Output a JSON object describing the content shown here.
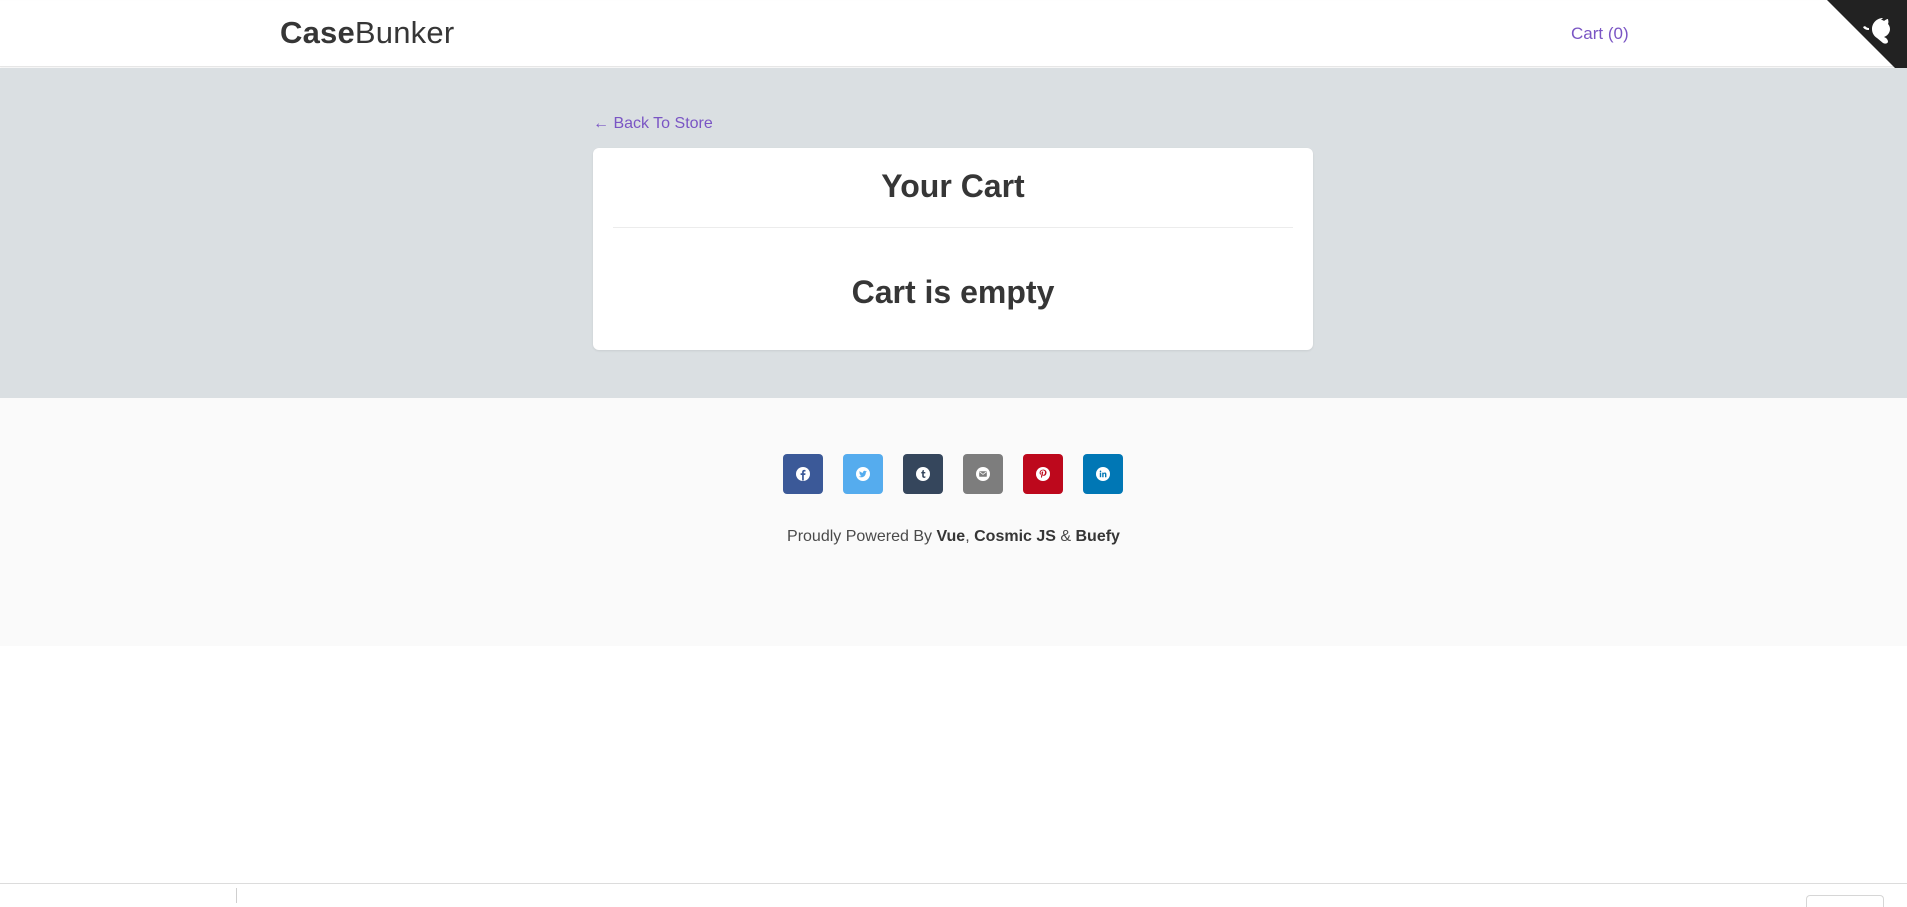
{
  "navbar": {
    "brand_bold": "Case",
    "brand_rest": "Bunker",
    "cart_label": "Cart (0)"
  },
  "hero": {
    "back_link": "← Back To Store",
    "card_title": "Your Cart",
    "empty_message": "Cart is empty"
  },
  "footer": {
    "social": [
      {
        "name": "facebook-icon",
        "color": "#3b5998"
      },
      {
        "name": "twitter-icon",
        "color": "#55acee"
      },
      {
        "name": "tumblr-icon",
        "color": "#35465c"
      },
      {
        "name": "email-icon",
        "color": "#7d7d7d"
      },
      {
        "name": "pinterest-icon",
        "color": "#bd081c"
      },
      {
        "name": "linkedin-icon",
        "color": "#0077b5"
      }
    ],
    "powered_prefix": "Proudly Powered By",
    "powered_vue": "Vue",
    "powered_sep1": ",",
    "powered_cosmic": "Cosmic JS",
    "powered_amp": "&",
    "powered_buefy": "Buefy"
  },
  "colors": {
    "accent": "#7a55c4",
    "hero_bg": "#dadfe2",
    "footer_bg": "#fafafa"
  }
}
